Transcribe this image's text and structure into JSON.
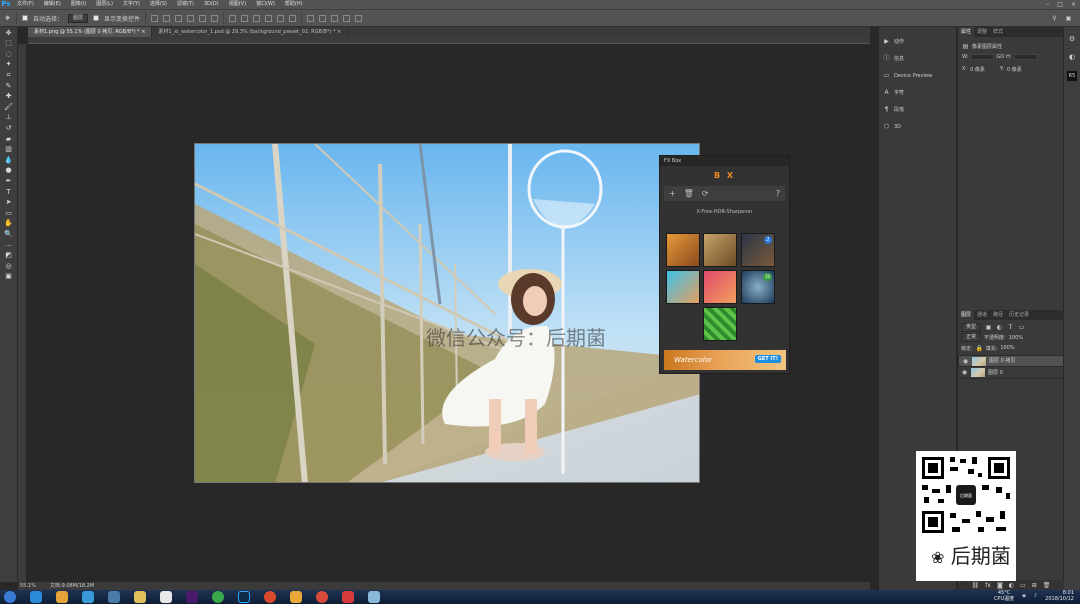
{
  "app": {
    "logo": "Ps"
  },
  "menu": [
    "文件(F)",
    "编辑(E)",
    "图像(I)",
    "图层(L)",
    "文字(Y)",
    "选择(S)",
    "滤镜(T)",
    "3D(D)",
    "视图(V)",
    "窗口(W)",
    "帮助(H)"
  ],
  "window_controls": [
    "–",
    "□",
    "×"
  ],
  "options": {
    "auto_select_label": "自动选择：",
    "auto_select_value": "图层",
    "show_transform_label": "显示变换控件"
  },
  "tabs": [
    {
      "label": "素材1.png @ 55.1% (图层 0 拷贝, RGB/8*) *",
      "close": "×"
    },
    {
      "label": "素材1_xi_watercolor_1.psd @ 29.3% (background_preset_02, RGB/8*) *",
      "close": "×"
    }
  ],
  "statusbar": {
    "zoom": "55.1%",
    "doc": "文档:9.08M/18.2M"
  },
  "panel_left": {
    "items": [
      {
        "icon": "play-icon",
        "glyph": "▶",
        "label": "动作"
      },
      {
        "icon": "info-icon",
        "glyph": "ⓘ",
        "label": "信息"
      },
      {
        "icon": "device-icon",
        "glyph": "▭",
        "label": "Device Preview"
      },
      {
        "icon": "character-icon",
        "glyph": "A",
        "label": "字符"
      },
      {
        "icon": "paragraph-icon",
        "glyph": "¶",
        "label": "段落"
      },
      {
        "icon": "cube-icon",
        "glyph": "⬡",
        "label": "3D"
      }
    ]
  },
  "properties": {
    "tabs": [
      "属性",
      "调整",
      "样式"
    ],
    "title": "像素图层属性",
    "w_label": "W:",
    "h_label": "H:",
    "go_label": "GO",
    "x_label": "X:",
    "x_value": "0 像素",
    "y_label": "Y:",
    "y_value": "0 像素"
  },
  "layers": {
    "tabs": [
      "图层",
      "通道",
      "路径",
      "历史记录"
    ],
    "kind": "类型",
    "blend": "正常",
    "opacity_label": "不透明度:",
    "opacity": "100%",
    "lock_label": "锁定:",
    "fill_label": "填充:",
    "fill": "100%",
    "items": [
      {
        "name": "图层 0 拷贝",
        "selected": true
      },
      {
        "name": "图层 0",
        "selected": false
      }
    ]
  },
  "fxbox": {
    "title": "FX Box",
    "brand": "B X",
    "add": "+",
    "delete": "🗑",
    "refresh": "⟳",
    "help": "?",
    "preset_label": "X-Free-HDR-Sharpener",
    "thumbs": [
      "watercolor-portrait",
      "wood-lion",
      "3d-box",
      "cyan-girl",
      "pink-portrait",
      "globe",
      "leaf-pattern"
    ],
    "thumb_badges": [
      "",
      "",
      "2",
      "",
      "",
      "10",
      ""
    ],
    "banner_text": "Watercolor",
    "banner_cta": "GET IT!"
  },
  "watermark": "微信公众号：后期菌",
  "qr_caption": "后期菌",
  "qr_center": "后期菌",
  "tray": {
    "weather": "45°C",
    "cpu": "CPU温度",
    "time": "8:01",
    "date": "2018/10/12"
  }
}
